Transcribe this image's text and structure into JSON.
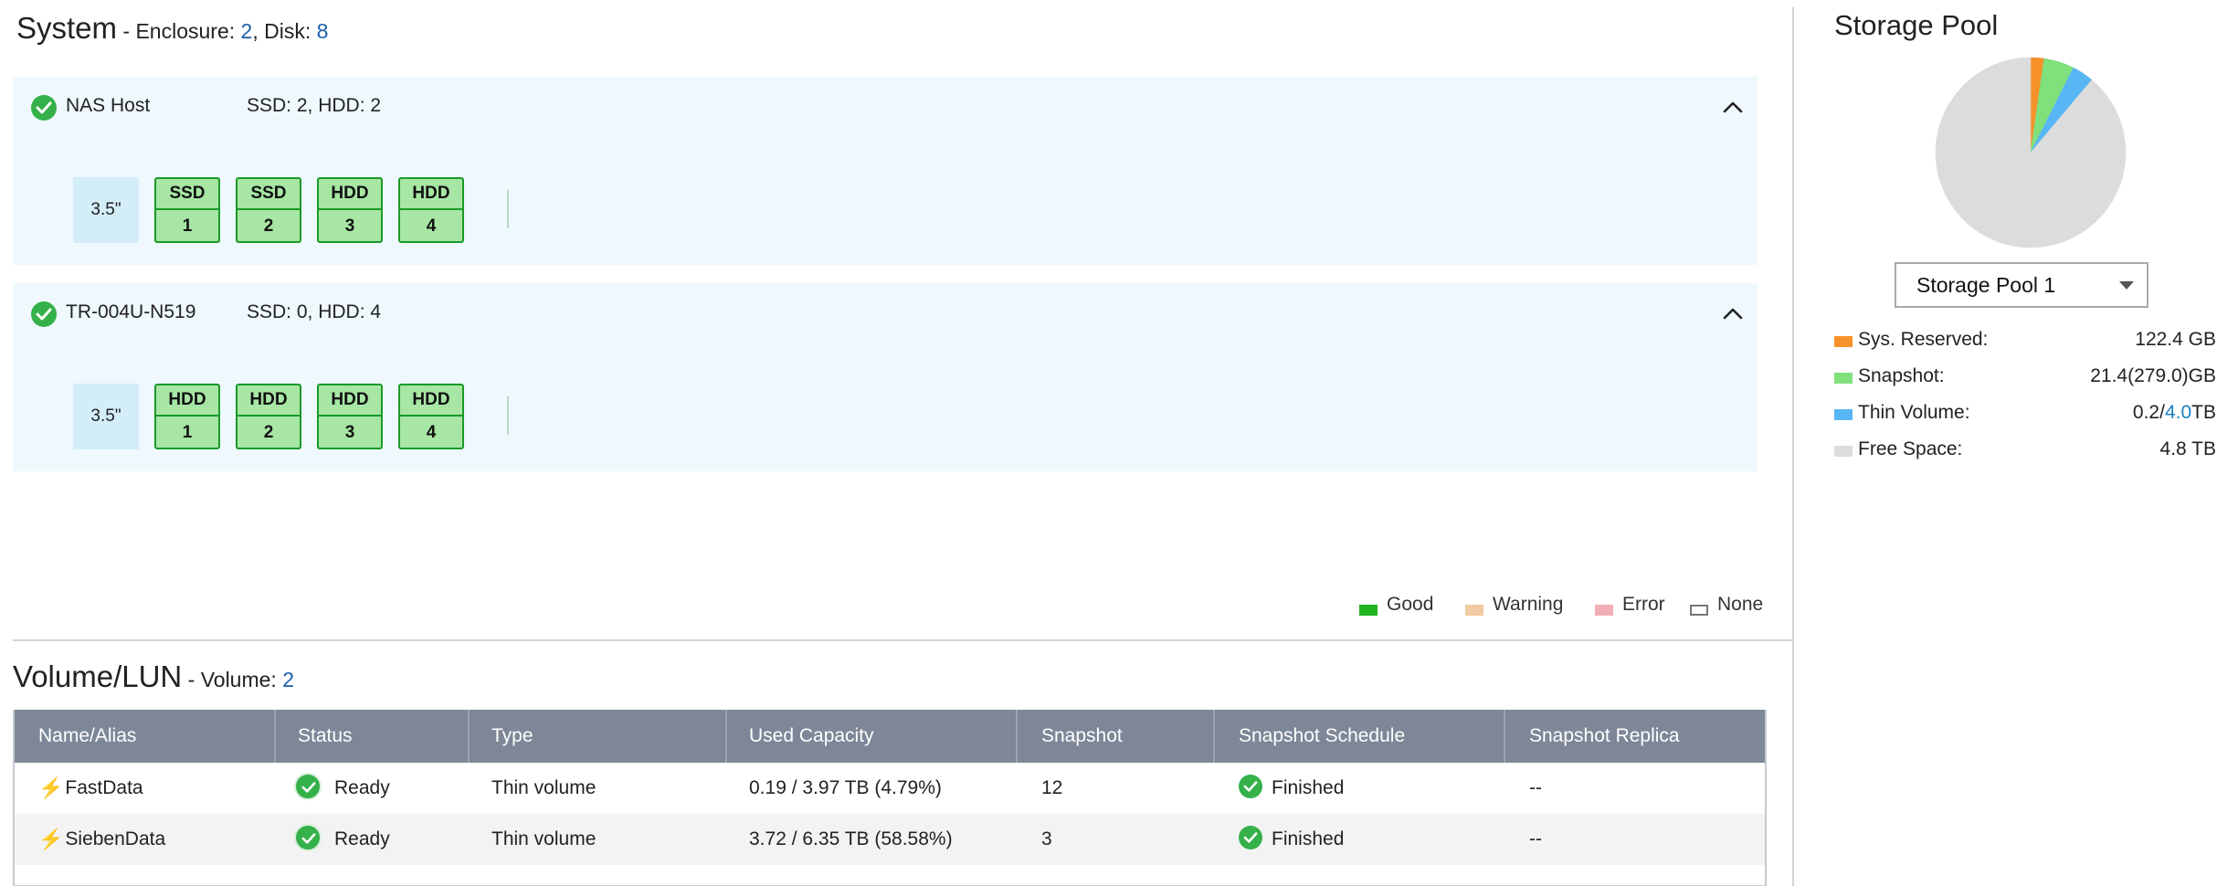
{
  "system": {
    "title": "System",
    "enclosure_label": " - Enclosure: ",
    "enclosure_count": "2",
    "disk_label": ", Disk: ",
    "disk_count": "8",
    "enclosures": [
      {
        "name": "NAS Host",
        "counts": "SSD: 2, HDD: 2",
        "form_factor": "3.5\"",
        "disks": [
          {
            "type": "SSD",
            "num": "1"
          },
          {
            "type": "SSD",
            "num": "2"
          },
          {
            "type": "HDD",
            "num": "3"
          },
          {
            "type": "HDD",
            "num": "4"
          }
        ]
      },
      {
        "name": "TR-004U-N519",
        "counts": "SSD: 0, HDD: 4",
        "form_factor": "3.5\"",
        "disks": [
          {
            "type": "HDD",
            "num": "1"
          },
          {
            "type": "HDD",
            "num": "2"
          },
          {
            "type": "HDD",
            "num": "3"
          },
          {
            "type": "HDD",
            "num": "4"
          }
        ]
      }
    ],
    "legend": [
      {
        "label": "Good",
        "color": "#1eb51e",
        "outline": false
      },
      {
        "label": "Warning",
        "color": "#f0caa0",
        "outline": false
      },
      {
        "label": "Error",
        "color": "#f2aeb5",
        "outline": false
      },
      {
        "label": "None",
        "color": "#ffffff",
        "outline": true
      }
    ]
  },
  "volumes": {
    "title": "Volume/LUN",
    "volume_label": " - Volume: ",
    "volume_count": "2",
    "columns": [
      "Name/Alias",
      "Status",
      "Type",
      "Used Capacity",
      "Snapshot",
      "Snapshot Schedule",
      "Snapshot Replica"
    ],
    "rows": [
      {
        "name": "FastData",
        "status": "Ready",
        "type": "Thin volume",
        "used": "0.19 / 3.97 TB (4.79%)",
        "snapshot": "12",
        "schedule": "Finished",
        "replica": "--"
      },
      {
        "name": "SiebenData",
        "status": "Ready",
        "type": "Thin volume",
        "used": "3.72 / 6.35 TB (58.58%)",
        "snapshot": "3",
        "schedule": "Finished",
        "replica": "--"
      }
    ]
  },
  "storage_pool": {
    "title": "Storage Pool",
    "selected": "Storage Pool 1",
    "usage": [
      {
        "label": "Sys. Reserved:",
        "value": "122.4 GB",
        "color": "#f7922a",
        "gb": 122.4
      },
      {
        "label": "Snapshot:",
        "value": "21.4(279.0)GB",
        "color": "#7fe07c",
        "gb": 279.0
      },
      {
        "label": "Thin Volume:",
        "value_pre": "0.2/",
        "value_blue": "4.0",
        "value_post": "TB",
        "color": "#59b6f5",
        "gb": 200
      },
      {
        "label": "Free Space:",
        "value": "4.8 TB",
        "color": "#dcdcdc",
        "gb": 4800
      }
    ]
  },
  "icons": {
    "status": "check-circle-icon",
    "collapse": "chevron-up-icon",
    "volume_type": "lightning-bolt-icon",
    "dropdown": "caret-down-icon"
  }
}
